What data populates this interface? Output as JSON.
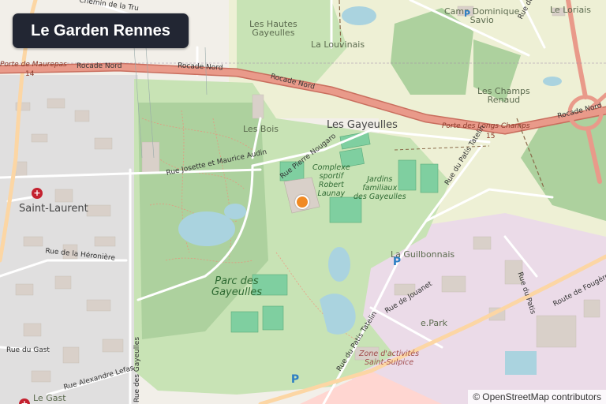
{
  "title": "Le Garden Rennes",
  "attribution": {
    "symbol": "©",
    "text": "OpenStreetMap contributors"
  },
  "colors": {
    "marker": "#f08a24",
    "title_bg": "#222633",
    "motorway": "#e99a8a",
    "park": "#c8e3b5",
    "pitch": "#7fcfa0",
    "water": "#aad3df"
  },
  "icons": {
    "marker": "orange-location-dot",
    "parking": "parking-P",
    "hospital": "hospital-cross"
  },
  "labels": {
    "chemin_tru": "Chemin de la Tru",
    "hautes_gayeulles": "Les Hautes\nGayeulles",
    "la_louvinais": "La Louvinais",
    "camp_dominique": "Camp Dominique\nSavio",
    "rue_saint_sulpice": "Rue de Saint-Sul",
    "le_loriais": "Le Loriais",
    "porte_maurepas": "Porte de Maurepas",
    "exit_14": "14",
    "rocade_nord_1": "Rocade Nord",
    "rocade_nord_2": "Rocade Nord",
    "rocade_nord_3": "Rocade Nord",
    "rocade_nord_4": "Rocade Nord",
    "les_champs_renaud": "Les Champs\nRenaud",
    "porte_longs_champs": "Porte des Longs Champs",
    "exit_15": "15",
    "les_bois": "Les Bois",
    "les_gayeulles": "Les Gayeulles",
    "rue_nougaro": "Rue Pierre Nougaro",
    "rue_audin": "Rue Josette et Maurice Audin",
    "complexe": "Complexe\nsportif\nRobert\nLaunay",
    "jardins": "Jardins\nfamiliaux\ndes Gayeulles",
    "rue_patis_tatelin_n": "Rue du Patis Tatelin",
    "saint_laurent": "Saint-Laurent",
    "rue_heronniere": "Rue de la Héronière",
    "la_guilbonnais": "La Guilbonnais",
    "parc_gayeulles": "Parc des\nGayeulles",
    "rue_du_patis": "Rue du Patis",
    "route_fougeres": "Route de Fougères",
    "rue_gast": "Rue du Gast",
    "rue_jouanet": "Rue de Jouanet",
    "epark": "e.Park",
    "rue_patis_tatelin_s": "Rue du Patis Tatelin",
    "zone_activites": "Zone d'activités\nSaint-Sulpice",
    "rue_lefas": "Rue Alexandre Lefas",
    "rue_gayeulles": "Rue des Gayeulles",
    "le_gast": "Le Gast"
  }
}
